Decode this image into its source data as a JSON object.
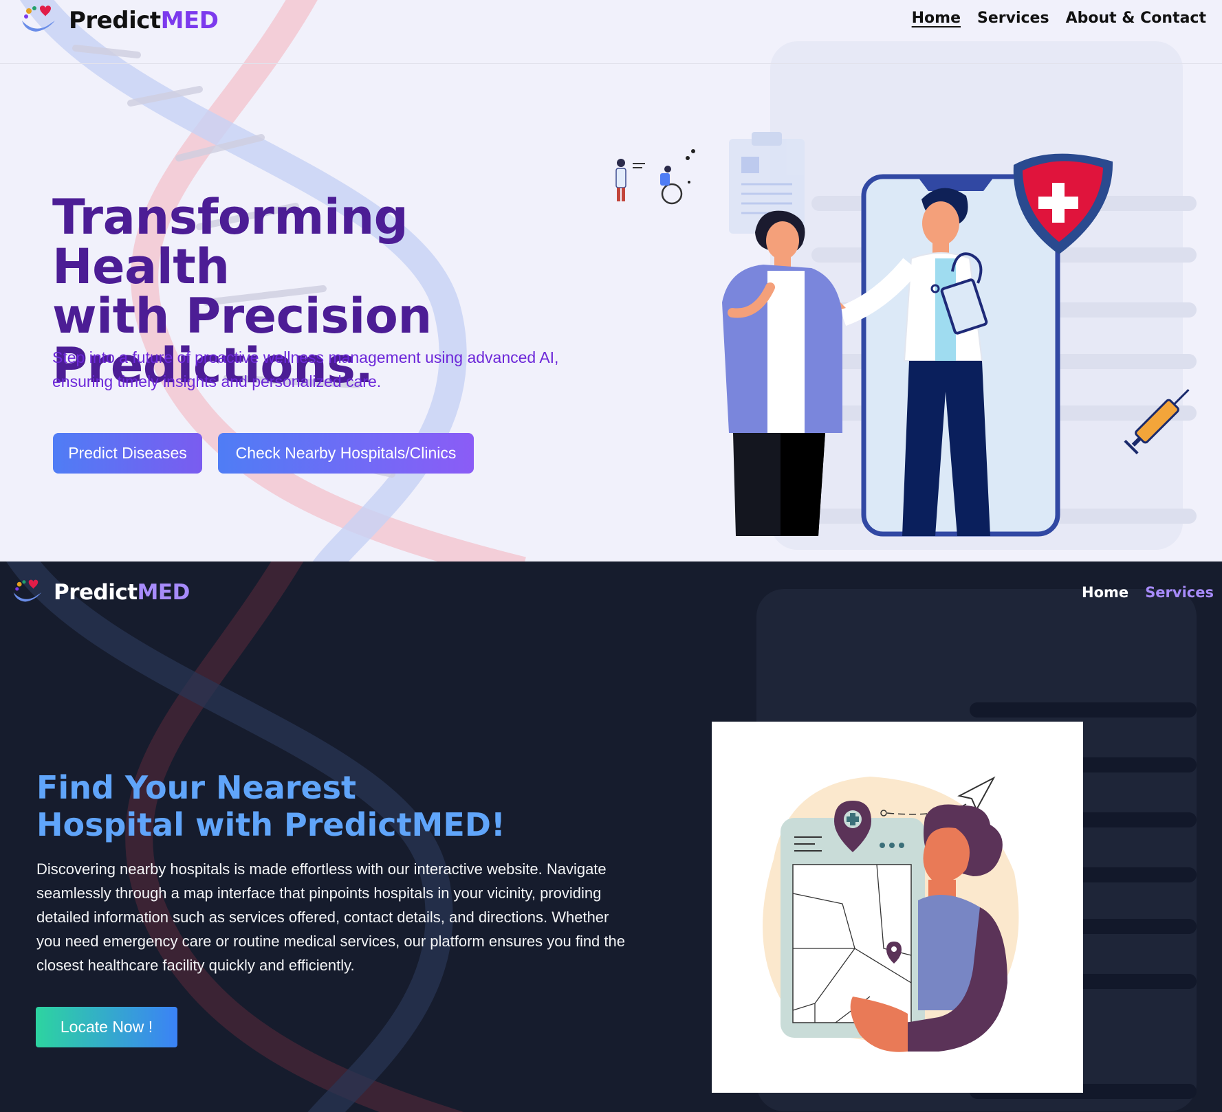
{
  "light": {
    "brand": {
      "name_main": "Predict",
      "name_accent": "MED"
    },
    "nav": [
      {
        "label": "Home",
        "active": true
      },
      {
        "label": "Services",
        "active": false
      },
      {
        "label": "About & Contact",
        "active": false
      }
    ],
    "hero": {
      "title_line1": "Transforming Health",
      "title_line2": "with Precision",
      "title_line3": "Predictions.",
      "subtitle_line1": "Step into a future of proactive wellness management using advanced AI,",
      "subtitle_line2": "ensuring timely insights and personalized care.",
      "btn_predict": "Predict Diseases",
      "btn_hospitals": "Check Nearby Hospitals/Clinics"
    }
  },
  "dark": {
    "brand": {
      "name_main": "Predict",
      "name_accent": "MED"
    },
    "nav": [
      {
        "label": "Home",
        "active": false
      },
      {
        "label": "Services",
        "active": true
      }
    ],
    "section": {
      "title_line1": "Find Your Nearest",
      "title_line2": "Hospital with PredictMED!",
      "description": "Discovering nearby hospitals is made effortless with our interactive website. Navigate seamlessly through a map interface that pinpoints hospitals in your vicinity, providing detailed information such as services offered, contact details, and directions. Whether you need emergency care or routine medical services, our platform ensures you find the closest healthcare facility quickly and efficiently.",
      "btn_locate": "Locate Now !"
    }
  },
  "colors": {
    "primary_purple": "#4c1d95",
    "accent_purple": "#7c3aed",
    "dark_bg": "#161c2d",
    "title_blue": "#60a5fa"
  },
  "icons": [
    "predictmed-logo-icon",
    "doctor-illustration-icon",
    "shield-plus-icon",
    "syringe-icon",
    "map-pin-icon",
    "paper-plane-icon"
  ]
}
